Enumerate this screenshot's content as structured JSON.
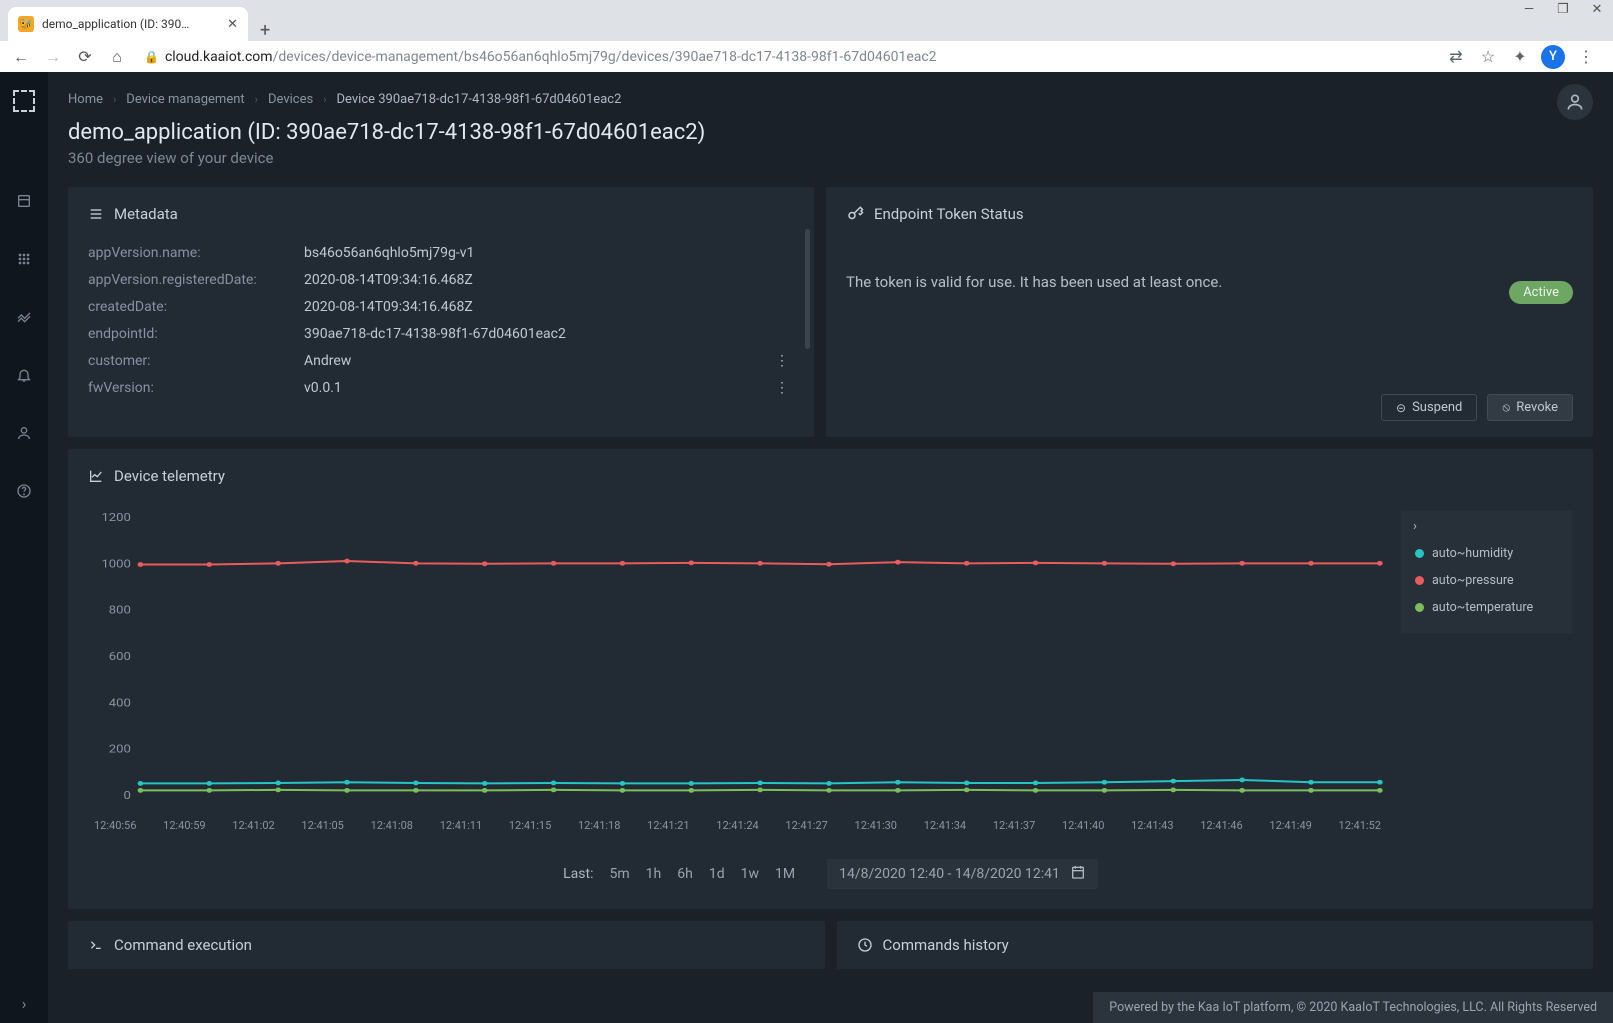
{
  "browser": {
    "tab_title": "demo_application (ID: 390…",
    "url_host": "cloud.kaaiot.com",
    "url_path": "/devices/device-management/bs46o56an6qhlo5mj79g/devices/390ae718-dc17-4138-98f1-67d04601eac2",
    "profile_initial": "Y"
  },
  "breadcrumb": {
    "home": "Home",
    "device_management": "Device management",
    "devices": "Devices",
    "current": "Device 390ae718-dc17-4138-98f1-67d04601eac2"
  },
  "page": {
    "title": "demo_application (ID: 390ae718-dc17-4138-98f1-67d04601eac2)",
    "subtitle": "360 degree view of your device"
  },
  "metadata": {
    "header": "Metadata",
    "rows": [
      {
        "key": "appVersion.name:",
        "val": "bs46o56an6qhlo5mj79g-v1",
        "more": false
      },
      {
        "key": "appVersion.registeredDate:",
        "val": "2020-08-14T09:34:16.468Z",
        "more": false
      },
      {
        "key": "createdDate:",
        "val": "2020-08-14T09:34:16.468Z",
        "more": false
      },
      {
        "key": "endpointId:",
        "val": "390ae718-dc17-4138-98f1-67d04601eac2",
        "more": false
      },
      {
        "key": "customer:",
        "val": "Andrew",
        "more": true
      },
      {
        "key": "fwVersion:",
        "val": "v0.0.1",
        "more": true
      }
    ]
  },
  "token": {
    "header": "Endpoint Token Status",
    "message": "The token is valid for use. It has been used at least once.",
    "badge": "Active",
    "suspend_label": "Suspend",
    "revoke_label": "Revoke"
  },
  "telemetry": {
    "header": "Device telemetry",
    "legend": [
      {
        "name": "auto~humidity",
        "color": "#27c4c4"
      },
      {
        "name": "auto~pressure",
        "color": "#e85c5c"
      },
      {
        "name": "auto~temperature",
        "color": "#7bbf5a"
      }
    ],
    "time": {
      "last_label": "Last:",
      "options": [
        "5m",
        "1h",
        "6h",
        "1d",
        "1w",
        "1M"
      ],
      "range": "14/8/2020 12:40 - 14/8/2020 12:41"
    }
  },
  "chart_data": {
    "type": "line",
    "ylabel": "",
    "xlabel": "",
    "ylim": [
      0,
      1200
    ],
    "y_ticks": [
      0,
      200,
      400,
      600,
      800,
      1000,
      1200
    ],
    "categories": [
      "12:40:56",
      "12:40:59",
      "12:41:02",
      "12:41:05",
      "12:41:08",
      "12:41:11",
      "12:41:15",
      "12:41:18",
      "12:41:21",
      "12:41:24",
      "12:41:27",
      "12:41:30",
      "12:41:34",
      "12:41:37",
      "12:41:40",
      "12:41:43",
      "12:41:46",
      "12:41:49",
      "12:41:52"
    ],
    "series": [
      {
        "name": "auto~pressure",
        "color": "#e85c5c",
        "values": [
          995,
          995,
          1000,
          1010,
          1000,
          998,
          1000,
          1000,
          1002,
          1000,
          996,
          1005,
          1000,
          1002,
          1000,
          998,
          1000,
          1000,
          1000
        ]
      },
      {
        "name": "auto~humidity",
        "color": "#27c4c4",
        "values": [
          50,
          50,
          52,
          55,
          52,
          50,
          52,
          50,
          50,
          52,
          50,
          55,
          52,
          52,
          55,
          60,
          65,
          55,
          55
        ]
      },
      {
        "name": "auto~temperature",
        "color": "#7bbf5a",
        "values": [
          20,
          20,
          22,
          20,
          20,
          20,
          22,
          20,
          20,
          22,
          20,
          20,
          22,
          20,
          20,
          22,
          20,
          20,
          20
        ]
      }
    ]
  },
  "bottom": {
    "command_exec": "Command execution",
    "commands_history": "Commands history"
  },
  "footer": "Powered by the Kaa IoT platform, © 2020 KaaIoT Technologies, LLC. All Rights Reserved"
}
